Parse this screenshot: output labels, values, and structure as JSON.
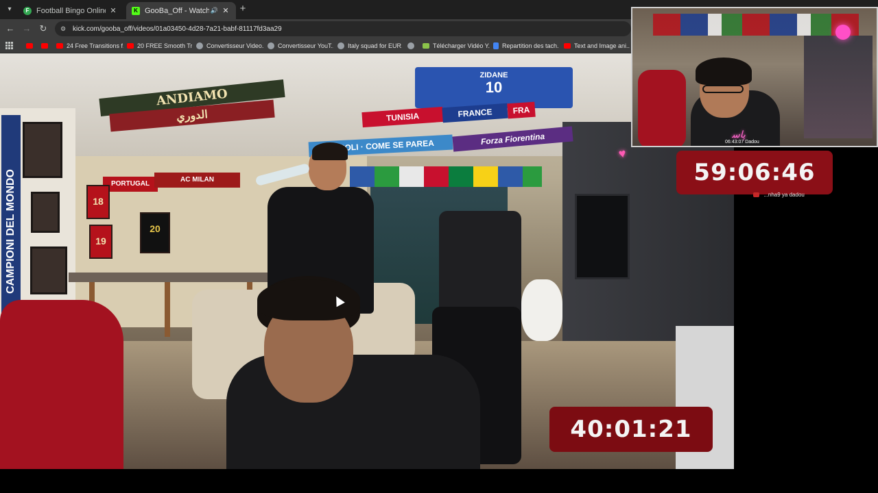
{
  "tabs": [
    {
      "title": "Football Bingo Online - Play Now",
      "close": "✕",
      "favicon": "F"
    },
    {
      "title": "GooBa_Off - Watch the VOD",
      "close": "✕",
      "favicon": "K",
      "audio_icon": "speaker-icon"
    }
  ],
  "tab_menu_icon": "▾",
  "new_tab_icon": "+",
  "nav": {
    "back": "←",
    "forward": "→",
    "reload": "↻"
  },
  "address_bar": {
    "url": "kick.com/gooba_off/videos/01a03450-4d28-7a21-babf-81117fd3aa29",
    "site_icon": "tune-icon"
  },
  "bookmarks": [
    {
      "label": "",
      "icon": "youtube"
    },
    {
      "label": "",
      "icon": "youtube"
    },
    {
      "label": "24 Free Transitions f...",
      "icon": "youtube"
    },
    {
      "label": "20 FREE Smooth Tra...",
      "icon": "youtube"
    },
    {
      "label": "Convertisseur Video...",
      "icon": "globe"
    },
    {
      "label": "Convertisseur YouT...",
      "icon": "globe"
    },
    {
      "label": "Italy squad for EUR...",
      "icon": "globe"
    },
    {
      "label": "",
      "icon": "globe"
    },
    {
      "label": "Télécharger Vidéo Y...",
      "icon": "download"
    },
    {
      "label": "Repartition des tach...",
      "icon": "doc"
    },
    {
      "label": "Text and Image ani...",
      "icon": "youtube"
    }
  ],
  "video": {
    "scene_text": {
      "andiamo": "ANDIAMO",
      "arabic_scarf": "ﺍﻟﺪﻭﺭﻱ",
      "jersey_name": "ZIDANE",
      "jersey_number": "10",
      "tunisia": "TUNISIA",
      "france": "FRANCE",
      "fra": "FRA",
      "napoli": "NAPOLI · COME SE PAREA",
      "fiorentina": "Forza Fiorentina",
      "portugal": "PORTUGAL",
      "acmilan": "AC MILAN",
      "campioni": "CAMPIONI DEL MONDO",
      "shirt1": "18",
      "shirt2": "19",
      "shirt3": "20"
    },
    "timer_bottom": "40:01:21"
  },
  "stream_overlay": {
    "timer_top": "59:06:46",
    "webcam_caption": "06:43:07 Dadou",
    "chat_message": "...nha9 ya dadou"
  },
  "colors": {
    "timer_bg": "#7c0c12",
    "kick_green": "#53fc18",
    "tab_active": "#3c3c3c"
  }
}
